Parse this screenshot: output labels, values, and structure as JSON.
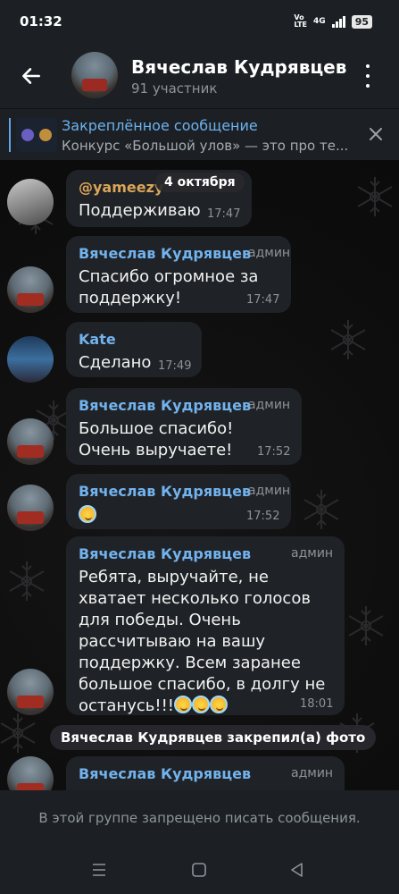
{
  "status_bar": {
    "time": "01:32",
    "volte": "Vo\nLTE",
    "network": "4G",
    "battery": "95"
  },
  "header": {
    "title": "Вячеслав Кудрявцев",
    "subtitle": "91 участник"
  },
  "pinned": {
    "title": "Закреплённое сообщение",
    "text": "Конкурс «Большой улов» — это про те..."
  },
  "date_chip": "4 октября",
  "messages": [
    {
      "author": "@yameezy",
      "text": "Поддерживаю",
      "time": "17:47"
    },
    {
      "author": "Вячеслав Кудрявцев",
      "role": "админ",
      "text": "Спасибо огромное за поддержку!",
      "time": "17:47"
    },
    {
      "author": "Kate",
      "text": "Сделано",
      "time": "17:49"
    },
    {
      "author": "Вячеслав Кудрявцев",
      "role": "админ",
      "text": "Большое спасибо! Очень выручаете!",
      "time": "17:52"
    },
    {
      "author": "Вячеслав Кудрявцев",
      "role": "админ",
      "text": "",
      "time": "17:52"
    },
    {
      "author": "Вячеслав Кудрявцев",
      "role": "админ",
      "text": "Ребята, выручайте, не хватает несколько голосов для победы. Очень рассчитываю на вашу поддержку. Всем заранее большое спасибо, в долгу не останусь!!!",
      "time": "18:01"
    },
    {
      "author": "Вячеслав Кудрявцев",
      "role": "админ",
      "text": "",
      "time": ""
    }
  ],
  "service_message": "Вячеслав Кудрявцев закрепил(а) фото",
  "footer": {
    "text": "В этой группе запрещено писать сообщения."
  },
  "colors": {
    "accent": "#72b3ee",
    "bubble": "#1f2226",
    "bar": "#1c2024"
  },
  "icons": [
    "back-arrow-icon",
    "more-vert-icon",
    "close-icon",
    "smile-halo-emoji",
    "menu-icon",
    "home-icon",
    "back-nav-icon"
  ]
}
